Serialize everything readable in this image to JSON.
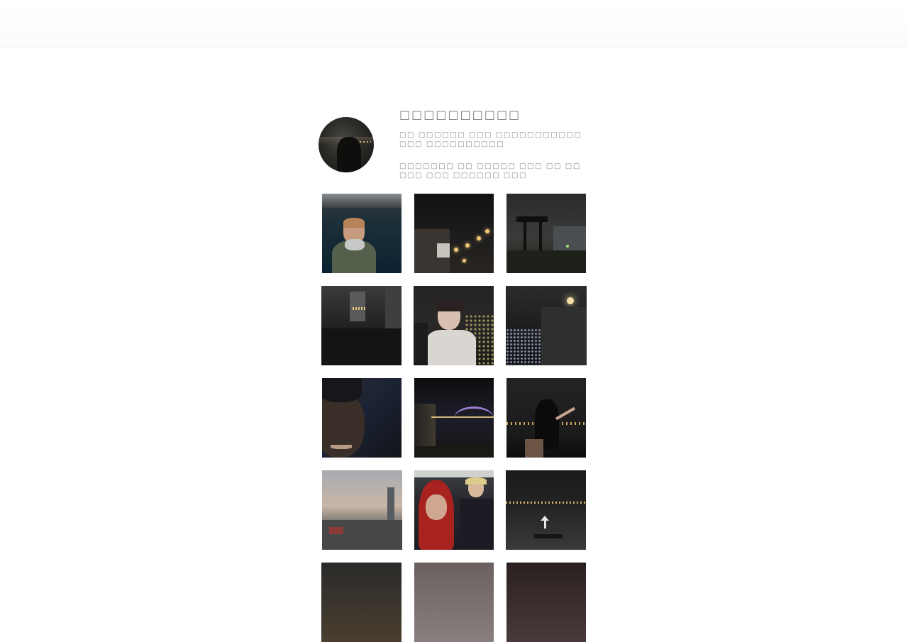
{
  "header": {
    "background": "#ffffff"
  },
  "profile": {
    "username": "□□□□□□□□□□",
    "bio_lines": [
      "□□ □□□□□□ □□□ □□□□□□□□□□□ □□□ □□□□□□□□□□",
      "□□□□□□□ □□ □□□□□ □□□ □□ □□□□□ □□□ □□□□□□ □□□"
    ],
    "avatar_icon": "profile-photo"
  },
  "posts": [
    {
      "id": "p1",
      "alt_icon": "photo-person-by-river"
    },
    {
      "id": "p2",
      "alt_icon": "photo-string-lights"
    },
    {
      "id": "p3",
      "alt_icon": "photo-watchtower-night"
    },
    {
      "id": "p4",
      "alt_icon": "photo-city-canal-night"
    },
    {
      "id": "p5",
      "alt_icon": "photo-selfie-peace-sign"
    },
    {
      "id": "p6",
      "alt_icon": "photo-city-lights-stairs"
    },
    {
      "id": "p7",
      "alt_icon": "photo-smiling-face-dark"
    },
    {
      "id": "p8",
      "alt_icon": "photo-bridge-fountain"
    },
    {
      "id": "p9",
      "alt_icon": "photo-woman-night-view"
    },
    {
      "id": "p10",
      "alt_icon": "photo-city-skyline-dusk"
    },
    {
      "id": "p11",
      "alt_icon": "photo-two-friends-hoods"
    },
    {
      "id": "p12",
      "alt_icon": "photo-road-arrow-night"
    },
    {
      "id": "p13",
      "alt_icon": "photo-partial"
    },
    {
      "id": "p14",
      "alt_icon": "photo-partial"
    },
    {
      "id": "p15",
      "alt_icon": "photo-partial"
    }
  ]
}
